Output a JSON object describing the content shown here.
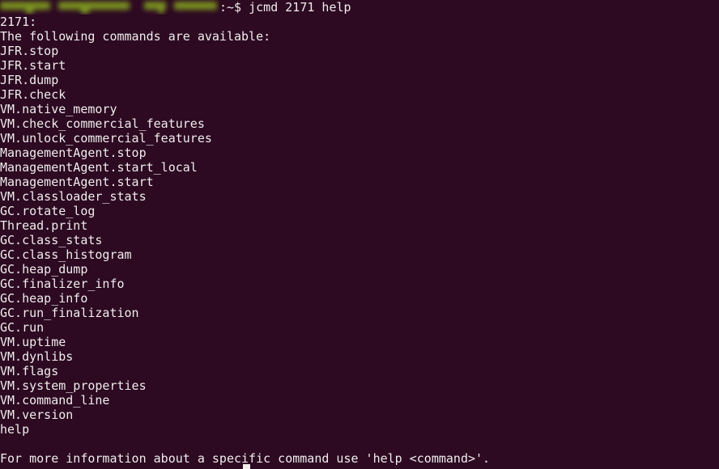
{
  "terminal": {
    "background_color": "#2d0922",
    "foreground_color": "#eeeeec",
    "redaction_color": "#7f9b1f",
    "cursor_color": "#eeeeec",
    "prompt_redacted_label": "redacted-user-at-host",
    "prompt_visible": ":~$ jcmd 2171 help",
    "command": "jcmd 2171 help",
    "cursor_char": " "
  },
  "output": {
    "pid_line": "2171:",
    "header": "The following commands are available:",
    "commands": [
      "JFR.stop",
      "JFR.start",
      "JFR.dump",
      "JFR.check",
      "VM.native_memory",
      "VM.check_commercial_features",
      "VM.unlock_commercial_features",
      "ManagementAgent.stop",
      "ManagementAgent.start_local",
      "ManagementAgent.start",
      "VM.classloader_stats",
      "GC.rotate_log",
      "Thread.print",
      "GC.class_stats",
      "GC.class_histogram",
      "GC.heap_dump",
      "GC.finalizer_info",
      "GC.heap_info",
      "GC.run_finalization",
      "GC.run",
      "VM.uptime",
      "VM.dynlibs",
      "VM.flags",
      "VM.system_properties",
      "VM.command_line",
      "VM.version",
      "help"
    ],
    "blank_line": "",
    "footer": "For more information about a specific command use 'help <command>'."
  }
}
